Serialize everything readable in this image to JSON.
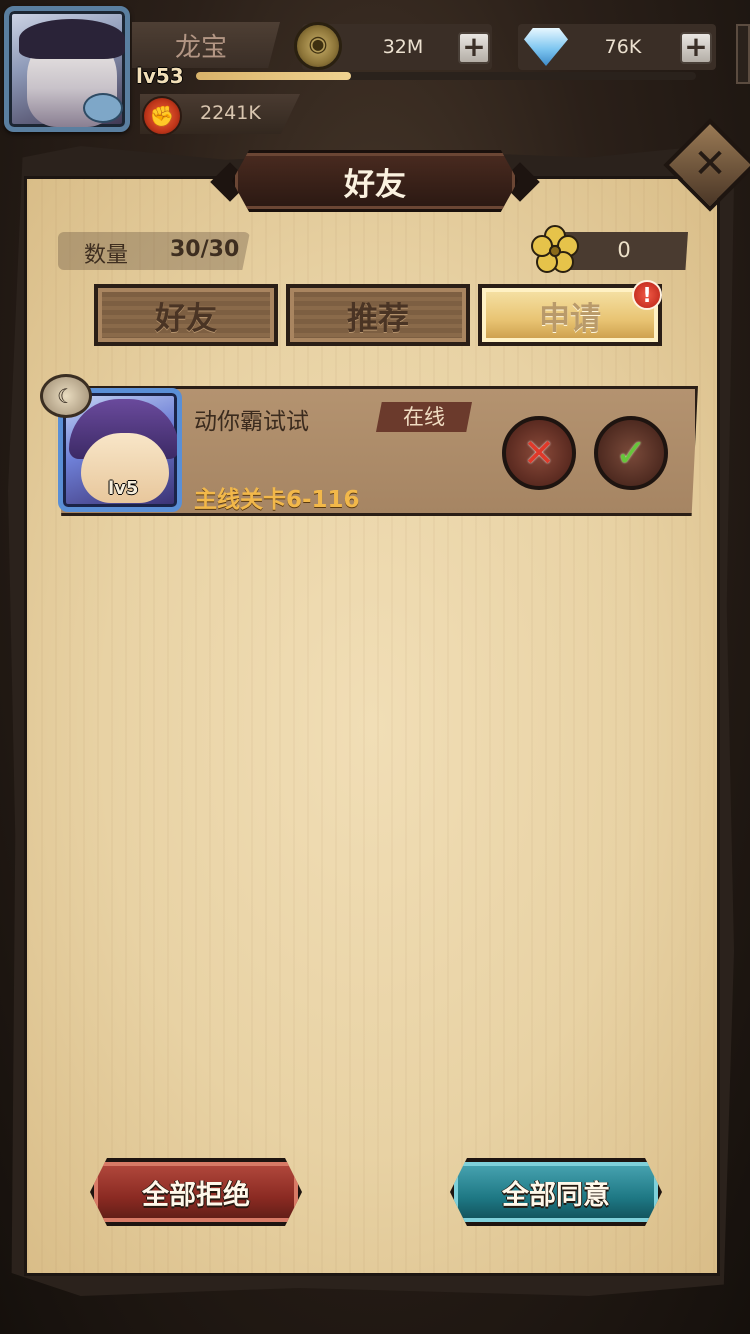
{
  "player": {
    "name": "龙宝",
    "level": "lv53",
    "xp_fraction": 0.31,
    "power": "2241K"
  },
  "currencies": {
    "gold": {
      "value": "32M",
      "icon": "gold-coin-icon"
    },
    "diamond": {
      "value": "76K",
      "icon": "diamond-icon"
    },
    "plus_label": "+"
  },
  "panel": {
    "title": "好友",
    "close_label": "✕"
  },
  "stats": {
    "count_label": "数量",
    "count_value": "30/30",
    "petal_value": "0"
  },
  "tabs": [
    {
      "label": "好友",
      "active": false
    },
    {
      "label": "推荐",
      "active": false
    },
    {
      "label": "申请",
      "active": true
    }
  ],
  "tab_badge": "!",
  "requests": [
    {
      "name": "动你霸试试",
      "status": "在线",
      "level_text": "lv5",
      "stage": "主线关卡6-116",
      "reject_symbol": "✕",
      "accept_symbol": "✓"
    }
  ],
  "actions": {
    "reject_all": "全部拒绝",
    "accept_all": "全部同意"
  },
  "colors": {
    "parchment": "#e8d2a4",
    "reject_red": "#8a2a22",
    "accept_teal": "#1e7884",
    "active_tab_gold": "#e8c372"
  }
}
